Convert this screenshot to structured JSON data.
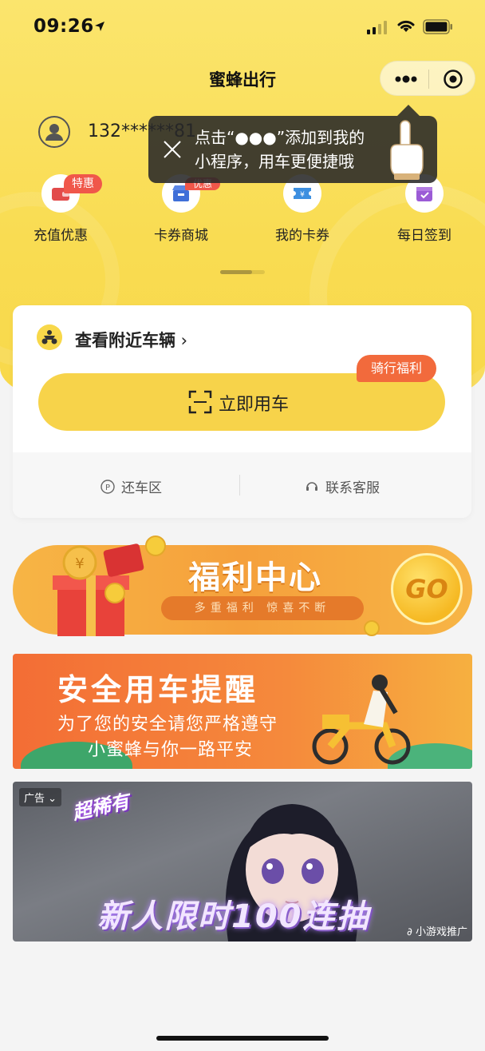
{
  "status_bar": {
    "time": "09:26"
  },
  "nav": {
    "title": "蜜蜂出行"
  },
  "user": {
    "phone": "132******81"
  },
  "tooltip": {
    "line1": "点击“●●●”添加到我的",
    "line2": "小程序，用车更便捷哦"
  },
  "quick_actions": [
    {
      "label": "充值优惠",
      "badge": "特惠",
      "icon": "wallet-icon",
      "color": "#e24b4b"
    },
    {
      "label": "卡券商城",
      "badge": "优惠",
      "icon": "shop-icon",
      "color": "#3f6fd8"
    },
    {
      "label": "我的卡券",
      "badge": "",
      "icon": "coupon-icon",
      "color": "#3d8fe0"
    },
    {
      "label": "每日签到",
      "badge": "",
      "icon": "calendar-icon",
      "color": "#9b5bd6"
    }
  ],
  "ride_card": {
    "nearby_label": "查看附近车辆",
    "use_button_label": "立即用车",
    "perk_tag": "骑行福利",
    "return_area_label": "还车区",
    "support_label": "联系客服"
  },
  "welfare_banner": {
    "title": "福利中心",
    "subtitle": "多重福利 惊喜不断",
    "go_label": "GO"
  },
  "safety_banner": {
    "title": "安全用车提醒",
    "line1": "为了您的安全请您严格遵守",
    "line2": "小蜜蜂与你一路平安"
  },
  "ad_banner": {
    "ad_tag": "广告 ⌄",
    "chip": "超稀有",
    "promo": "新人限时100连抽",
    "source": "小游戏推广"
  },
  "colors": {
    "brand_yellow": "#f8d84a",
    "accent_orange": "#f26a3c",
    "badge_red": "#f0574a"
  }
}
